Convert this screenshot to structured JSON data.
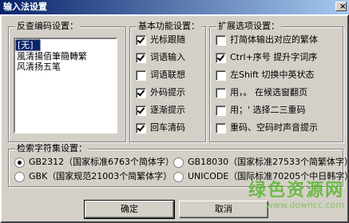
{
  "window": {
    "title": "输入法设置",
    "close_glyph": "×"
  },
  "reverse_coding": {
    "legend": "反查编码设置：",
    "items": [
      "[无]",
      "風清揚佰筆簡轉繁",
      "风清扬五笔"
    ],
    "selected_index": 0
  },
  "basic": {
    "legend": "基本功能设置：",
    "options": [
      {
        "label": "光标跟随",
        "checked": true
      },
      {
        "label": "词语输入",
        "checked": true
      },
      {
        "label": "词语联想",
        "checked": false
      },
      {
        "label": "外码提示",
        "checked": true
      },
      {
        "label": "逐渐提示",
        "checked": true
      },
      {
        "label": "回车清码",
        "checked": true
      }
    ]
  },
  "extended": {
    "legend": "扩展选项设置：",
    "options": [
      {
        "label": "打简体输出对应的繁体",
        "checked": false
      },
      {
        "label": "Ctrl+序号 提升字词序",
        "checked": true
      },
      {
        "label": "左Shift 切换中英状态",
        "checked": false
      },
      {
        "label": "用，。 在候选窗翻页",
        "checked": false
      },
      {
        "label": "用；' 选择二三重码",
        "checked": false
      },
      {
        "label": "重码、空码时声音提示",
        "checked": false
      }
    ]
  },
  "charset": {
    "legend": "检索字符集设置：",
    "options": [
      {
        "label": "GB2312（国家标准6763个简体字）",
        "checked": true
      },
      {
        "label": "GB18030（国家标准27533个简繁体字）",
        "checked": false
      },
      {
        "label": "GBK（国家规范21003个简繁体字）",
        "checked": false
      },
      {
        "label": "UNICODE（国际标准70205个中日韩字）",
        "checked": false
      }
    ]
  },
  "buttons": {
    "ok": "确定",
    "cancel": "取消"
  },
  "watermark": {
    "main": "绿色资源网",
    "sub": "www.downcc.com"
  }
}
